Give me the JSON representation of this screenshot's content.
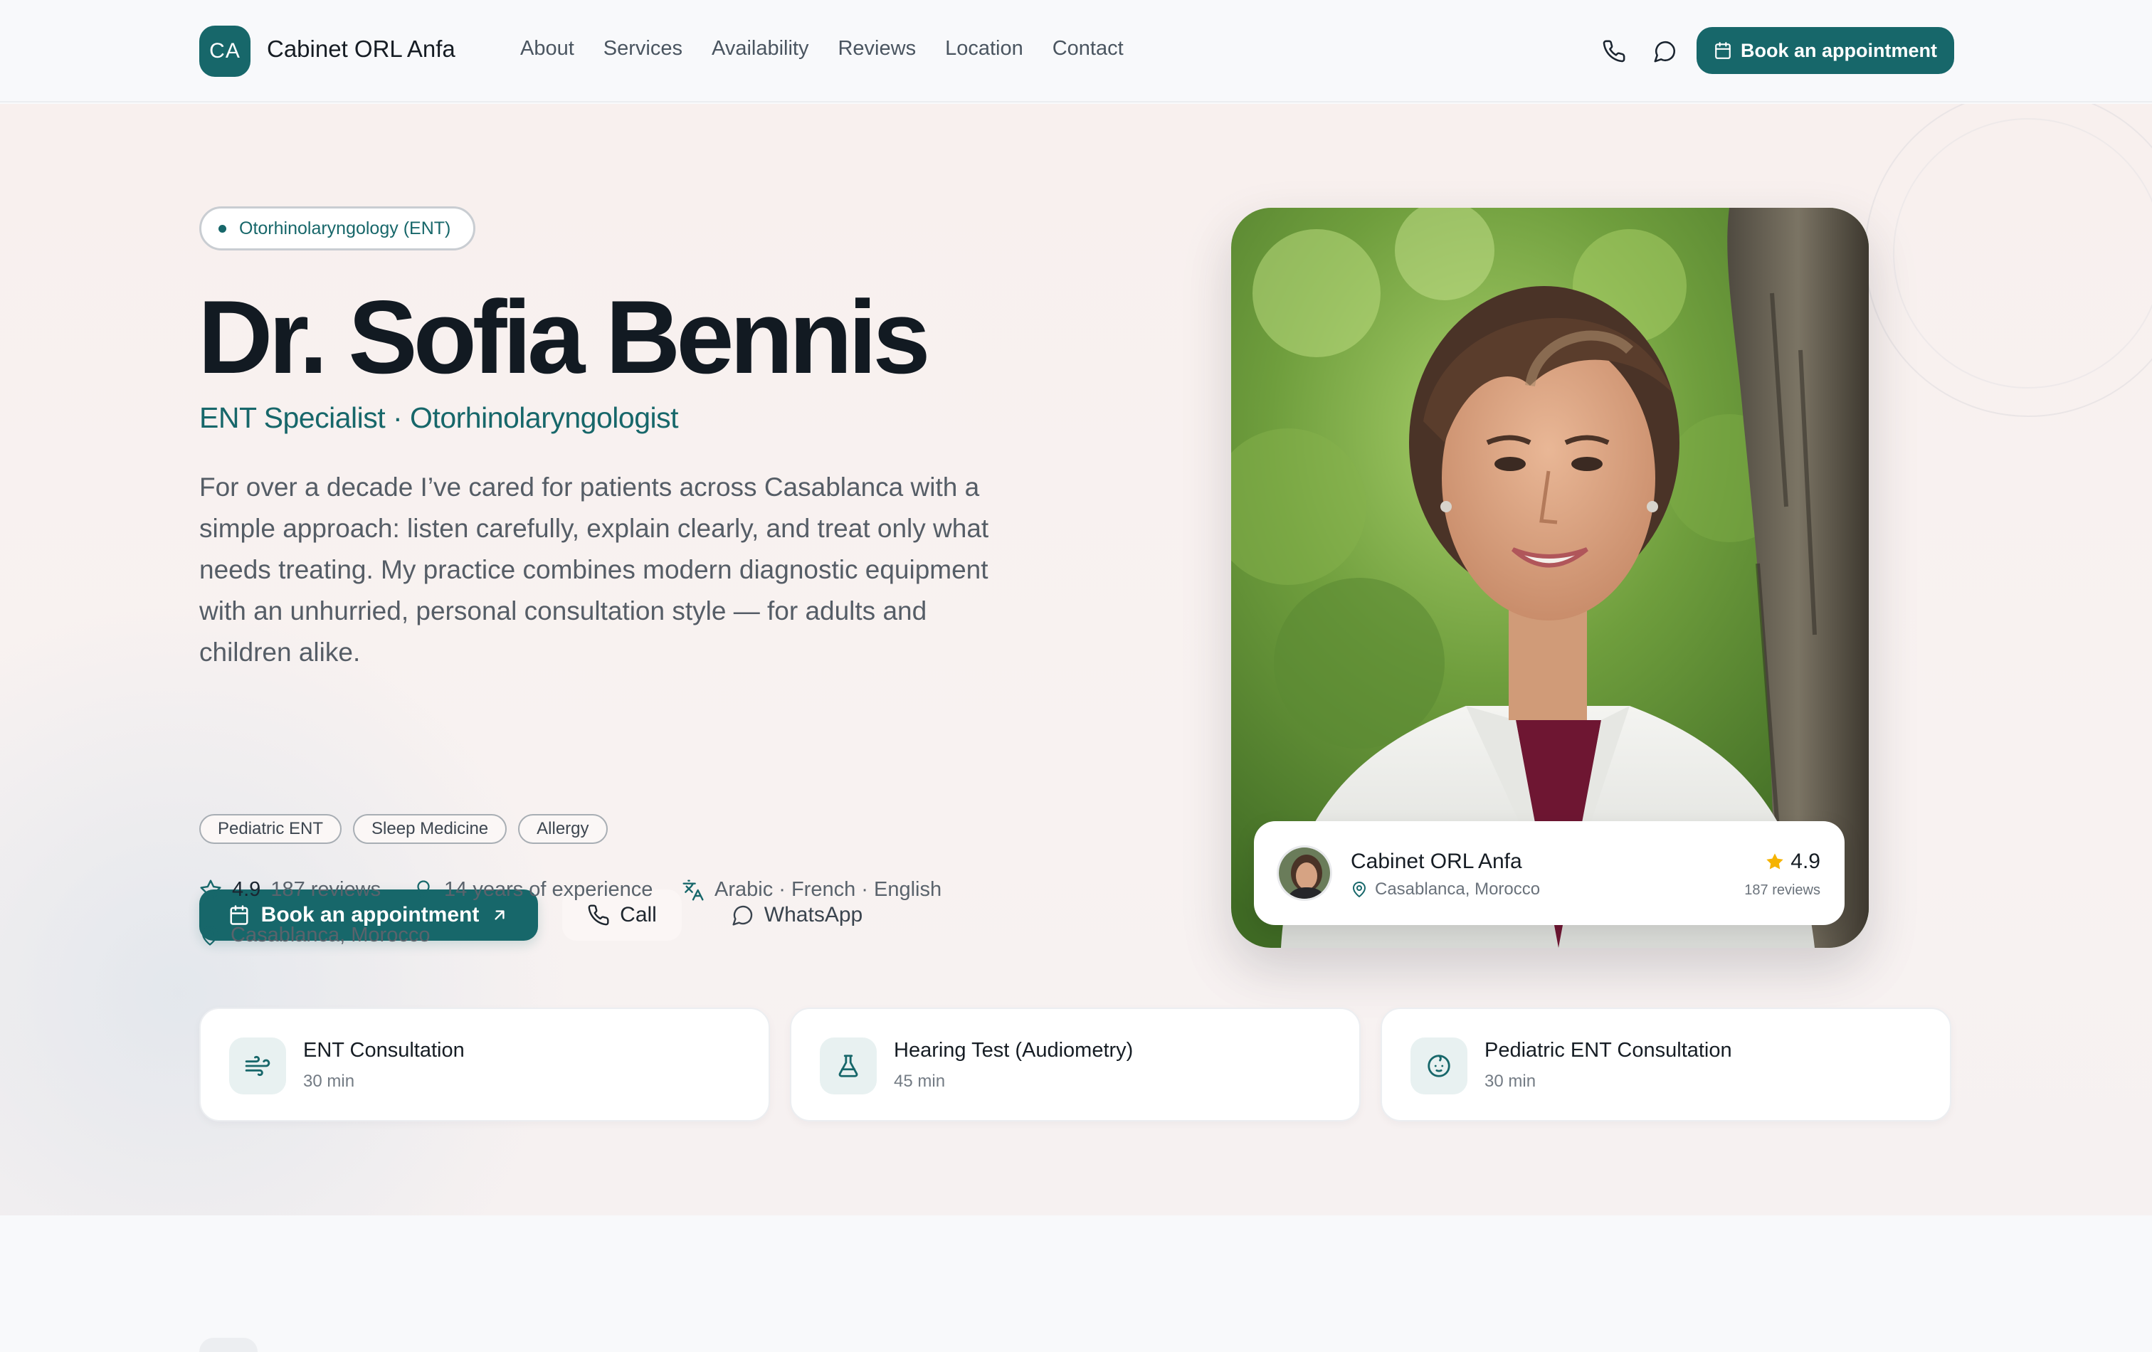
{
  "nav": {
    "logo_initials": "CA",
    "brand": "Cabinet ORL Anfa",
    "links": [
      "About",
      "Services",
      "Availability",
      "Reviews",
      "Location",
      "Contact"
    ],
    "phone_icon": "phone-icon",
    "whatsapp_icon": "chat-bubble-icon",
    "cta_label": "Book an appointment"
  },
  "hero": {
    "specialty": "Otorhinolaryngology (ENT)",
    "name": "Dr. Sofia Bennis",
    "title": "ENT Specialist · Otorhinolaryngologist",
    "bio": "For over a decade I’ve cared for patients across Casablanca with a simple approach: listen carefully, explain clearly, and treat only what needs treating. My practice combines modern diagnostic equipment with an unhurried, personal consultation style — for adults and children alike.",
    "tags": [
      "Pediatric ENT",
      "Sleep Medicine",
      "Allergy"
    ],
    "buttons": {
      "book": "Book an appointment",
      "call": "Call",
      "whatsapp": "WhatsApp"
    },
    "meta": {
      "rating": "4.9",
      "reviews": "187 reviews",
      "experience": "14 years of experience",
      "languages": "Arabic · French · English",
      "location": "Casablanca, Morocco"
    }
  },
  "photo_card": {
    "clinic": "Cabinet ORL Anfa",
    "location": "Casablanca, Morocco",
    "rating": "4.9",
    "reviews": "187 reviews"
  },
  "services": [
    {
      "name": "ENT Consultation",
      "duration": "30 min",
      "icon": "airflow-icon"
    },
    {
      "name": "Hearing Test (Audiometry)",
      "duration": "45 min",
      "icon": "flask-icon"
    },
    {
      "name": "Pediatric ENT Consultation",
      "duration": "30 min",
      "icon": "baby-face-icon"
    }
  ],
  "colors": {
    "accent": "#17676a",
    "star": "#f5b301",
    "heading": "#121a22",
    "body_text": "#555d66"
  }
}
